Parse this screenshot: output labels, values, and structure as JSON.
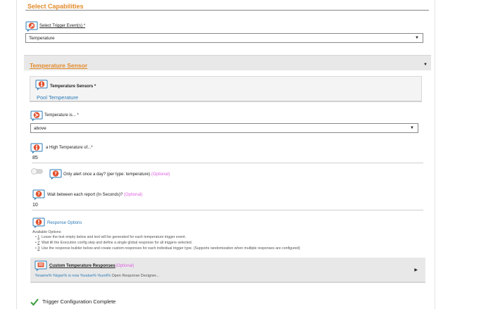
{
  "section": {
    "title": "Select Capabilities"
  },
  "trigger_event": {
    "label": "Select Trigger Event(s)",
    "required": "*",
    "value": "Temperature"
  },
  "sensor_panel": {
    "title": "Temperature Sensor"
  },
  "sensors": {
    "label": "Temperature Sensors",
    "required": "*",
    "value": "Pool Temperature"
  },
  "temperature_is": {
    "label": "Temperature is...",
    "required": "*",
    "value": "above"
  },
  "high_temp": {
    "label": "a High Temperature of...",
    "required": "*",
    "value": "85"
  },
  "once_a_day": {
    "label": "Only alert once a day? (per type: temperature)",
    "optional": "(Optional)"
  },
  "wait_between": {
    "label": "Wait between each report (In Seconds)?",
    "optional": "(Optional)",
    "value": "10"
  },
  "response_options": {
    "label": "Response Options",
    "available": "Available Options:",
    "items": [
      {
        "num": "1",
        "text": ": Leave the text empty below and text will be generated for each temperature trigger event."
      },
      {
        "num": "2",
        "text": ": Wait till the Execution config step and define a single global response for all triggers selected."
      },
      {
        "num": "3",
        "text": ": Use the response builder below and create custom responses for each individual trigger type. (Supports randomization when multiple responses are configured)"
      }
    ]
  },
  "custom_responses": {
    "title": "Custom Temperature Responses",
    "optional": "(Optional)",
    "tokens": "%name% %type% is now %value% %unit%",
    "designer": "Open Response Designer..."
  },
  "complete": {
    "label": "Trigger Configuration Complete"
  },
  "colors": {
    "accent": "#e38a2b",
    "link": "#2a7ab6",
    "optional": "#e060e0",
    "success": "#3a9a3a"
  },
  "icons": {
    "trigger": "trigger-event-icon",
    "sensor": "thermometer-icon",
    "compare": "comparison-icon",
    "question": "question-icon",
    "info": "info-icon",
    "check": "check-icon"
  }
}
